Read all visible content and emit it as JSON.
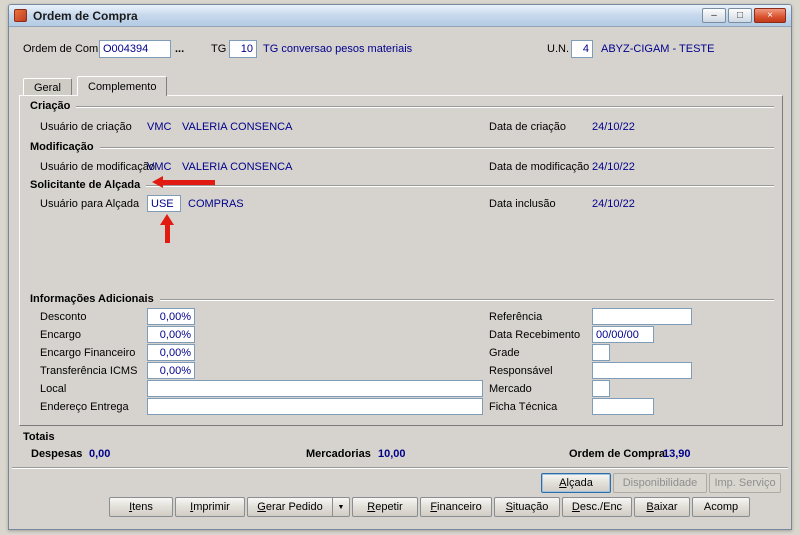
{
  "window": {
    "title": "Ordem de Compra",
    "minimize_glyph": "–",
    "maximize_glyph": "□",
    "close_glyph": "×"
  },
  "header": {
    "ordem_label": "Ordem de Compra",
    "ordem_value": "O004394",
    "browse_label": "...",
    "tg_label": "TG",
    "tg_value": "10",
    "tg_desc": "TG conversao pesos materiais",
    "un_label": "U.N.",
    "un_value": "4",
    "un_desc": "ABYZ-CIGAM - TESTE"
  },
  "tabs": [
    {
      "label": "Geral"
    },
    {
      "label": "Complemento"
    }
  ],
  "active_tab": "Complemento",
  "sections": {
    "criacao": {
      "title": "Criação",
      "user_label": "Usuário de criação",
      "user_code": "VMC",
      "user_name": "VALERIA CONSENCA",
      "date_label": "Data de criação",
      "date_value": "24/10/22"
    },
    "modificacao": {
      "title": "Modificação",
      "user_label": "Usuário de modificação",
      "user_code": "VMC",
      "user_name": "VALERIA CONSENCA",
      "date_label": "Data de modificação",
      "date_value": "24/10/22"
    },
    "alcada": {
      "title": "Solicitante de Alçada",
      "user_label": "Usuário para Alçada",
      "user_value": "USE",
      "user_name": "COMPRAS",
      "date_label": "Data inclusão",
      "date_value": "24/10/22"
    },
    "adicionais": {
      "title": "Informações Adicionais",
      "left": [
        {
          "label": "Desconto",
          "value": "0,00%"
        },
        {
          "label": "Encargo",
          "value": "0,00%"
        },
        {
          "label": "Encargo Financeiro",
          "value": "0,00%"
        },
        {
          "label": "Transferência ICMS",
          "value": "0,00%"
        },
        {
          "label": "Local",
          "value": ""
        },
        {
          "label": "Endereço Entrega",
          "value": ""
        }
      ],
      "right": [
        {
          "label": "Referência",
          "value": ""
        },
        {
          "label": "Data Recebimento",
          "value": "00/00/00"
        },
        {
          "label": "Grade",
          "value": ""
        },
        {
          "label": "Responsável",
          "value": ""
        },
        {
          "label": "Mercado",
          "value": ""
        },
        {
          "label": "Ficha Técnica",
          "value": ""
        }
      ]
    }
  },
  "totals": {
    "title": "Totais",
    "items": [
      {
        "label": "Despesas",
        "value": "0,00"
      },
      {
        "label": "Mercadorias",
        "value": "10,00"
      },
      {
        "label": "Ordem de Compra",
        "value": "13,90"
      }
    ]
  },
  "actions_top": [
    {
      "label": "Alçada",
      "enabled": true
    },
    {
      "label": "Disponibilidade",
      "enabled": false
    },
    {
      "label": "Imp. Serviço",
      "enabled": false
    }
  ],
  "actions_bottom": [
    "Itens",
    "Imprimir",
    "Gerar Pedido",
    "Repetir",
    "Financeiro",
    "Situação",
    "Desc./Enc",
    "Baixar",
    "Acomp"
  ],
  "icons": {
    "dropdown_arrow": "▼"
  },
  "colors": {
    "value_text": "#00008B",
    "annotation": "#e11b12"
  }
}
